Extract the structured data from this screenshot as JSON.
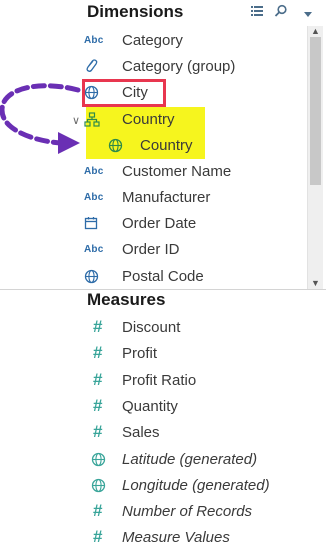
{
  "dimensions": {
    "title": "Dimensions",
    "items": [
      {
        "label": "Category",
        "icon": "abc",
        "icon_text": "Abc"
      },
      {
        "label": "Category (group)",
        "icon": "paperclip-icon"
      },
      {
        "label": "City",
        "icon": "globe-icon"
      },
      {
        "label": "Country",
        "icon": "hierarchy-icon"
      },
      {
        "label": "Country",
        "icon": "globe-icon"
      },
      {
        "label": "Customer Name",
        "icon": "abc",
        "icon_text": "Abc"
      },
      {
        "label": "Manufacturer",
        "icon": "abc",
        "icon_text": "Abc"
      },
      {
        "label": "Order Date",
        "icon": "calendar-icon"
      },
      {
        "label": "Order ID",
        "icon": "abc",
        "icon_text": "Abc"
      },
      {
        "label": "Postal Code",
        "icon": "globe-icon"
      }
    ]
  },
  "measures": {
    "title": "Measures",
    "items": [
      {
        "label": "Discount",
        "icon": "hash",
        "icon_text": "#"
      },
      {
        "label": "Profit",
        "icon": "hash",
        "icon_text": "#"
      },
      {
        "label": "Profit Ratio",
        "icon": "hash",
        "icon_text": "#"
      },
      {
        "label": "Quantity",
        "icon": "hash",
        "icon_text": "#"
      },
      {
        "label": "Sales",
        "icon": "hash",
        "icon_text": "#"
      },
      {
        "label": "Latitude (generated)",
        "icon": "globe-icon"
      },
      {
        "label": "Longitude (generated)",
        "icon": "globe-icon"
      },
      {
        "label": "Number of Records",
        "icon": "hash",
        "icon_text": "#"
      },
      {
        "label": "Measure Values",
        "icon": "hash",
        "icon_text": "#"
      }
    ]
  },
  "colors": {
    "highlight_box": "#e8364f",
    "highlight_fill": "#f6f51e",
    "arrow": "#6a2fb4",
    "dimension_icon": "#2e6ca8",
    "measure_icon": "#3aa59a"
  }
}
